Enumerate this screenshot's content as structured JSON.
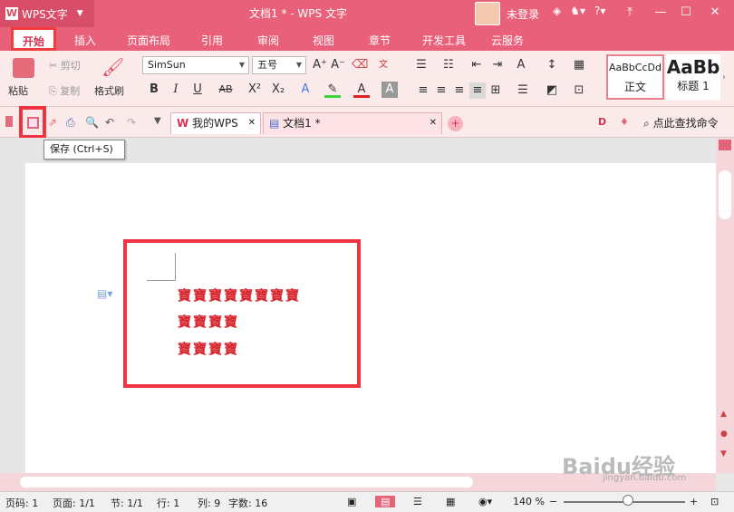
{
  "app": {
    "name": "WPS文字",
    "doc_title": "文档1 * - WPS 文字",
    "user": "未登录"
  },
  "tabs": [
    "开始",
    "插入",
    "页面布局",
    "引用",
    "审阅",
    "视图",
    "章节",
    "开发工具",
    "云服务"
  ],
  "clipboard": {
    "paste": "粘贴",
    "cut": "剪切",
    "copy": "复制",
    "format_painter": "格式刷"
  },
  "font": {
    "family": "SimSun",
    "size": "五号"
  },
  "styles": [
    {
      "preview": "AaBbCcDd",
      "name": "正文"
    },
    {
      "preview": "AaBb",
      "name": "标题 1"
    }
  ],
  "doc_tabs": [
    {
      "label": "我的WPS"
    },
    {
      "label": "文档1 *"
    }
  ],
  "search": "点此查找命令",
  "tooltip": "保存 (Ctrl+S)",
  "document": {
    "lines": [
      "寶寶寶寶寶寶寶寶",
      "寶寶寶寶",
      "寶寶寶寶"
    ]
  },
  "status": {
    "page_code": "页码: 1",
    "pages": "页面: 1/1",
    "section": "节: 1/1",
    "row": "行: 1",
    "col": "列: 9",
    "words": "字数: 16",
    "zoom": "140 %"
  },
  "watermark": {
    "brand": "Baidu经验",
    "url": "jingyan.baidu.com"
  },
  "colors": {
    "accent": "#e9607a",
    "highlight": "#ef3340",
    "text": "#d8262f"
  }
}
